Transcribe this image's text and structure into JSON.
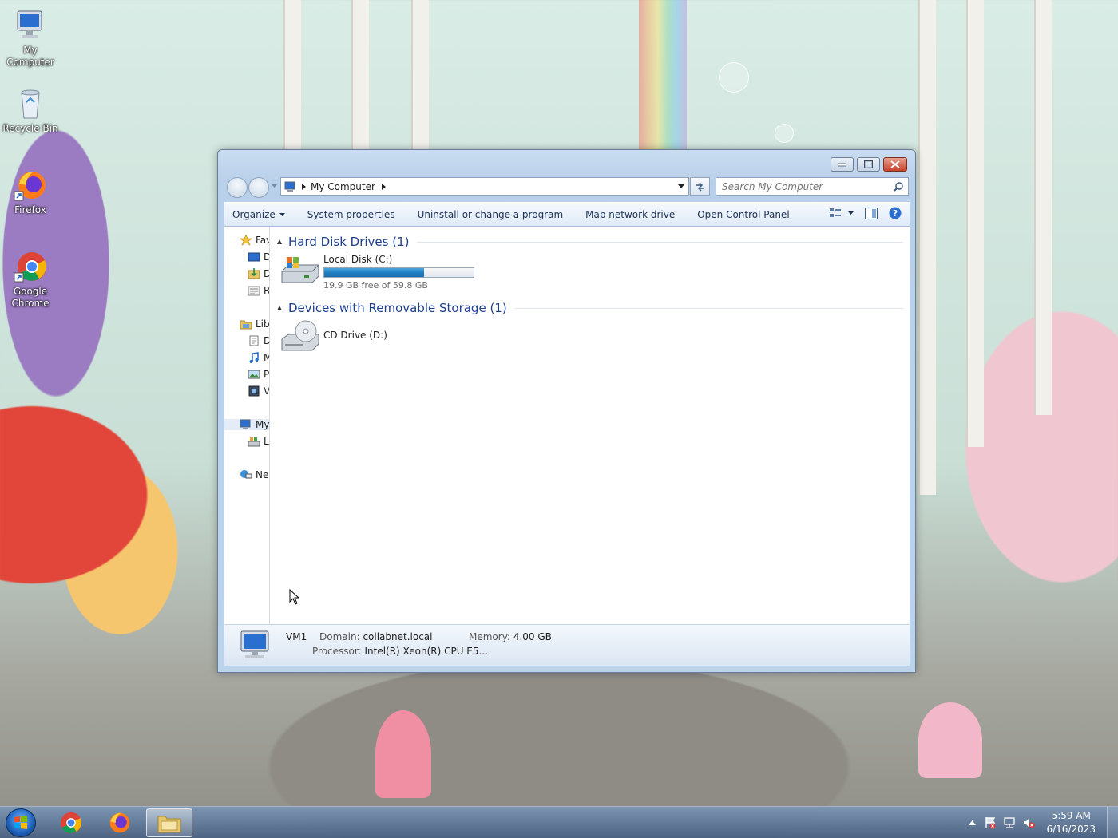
{
  "desktop": {
    "icons": [
      {
        "label": "My Computer"
      },
      {
        "label": "Recycle Bin"
      },
      {
        "label": "Firefox"
      },
      {
        "label": "Google Chrome"
      }
    ]
  },
  "window": {
    "address": {
      "crumb": "My Computer"
    },
    "search": {
      "placeholder": "Search My Computer"
    },
    "toolbar": {
      "organize": "Organize",
      "system_properties": "System properties",
      "uninstall": "Uninstall or change a program",
      "map_drive": "Map network drive",
      "control_panel": "Open Control Panel"
    },
    "nav": {
      "favorites": "Fav",
      "fav_items": [
        "D",
        "D",
        "R"
      ],
      "libraries": "Lib",
      "lib_items": [
        "D",
        "M",
        "P",
        "V"
      ],
      "computer": "My",
      "computer_items": [
        "L"
      ],
      "network": "Ne"
    },
    "groups": {
      "hard_disks": "Hard Disk Drives (1)",
      "removable": "Devices with Removable Storage (1)"
    },
    "drives": {
      "c": {
        "name": "Local Disk (C:)",
        "free_text": "19.9 GB free of 59.8 GB",
        "used_fraction": 0.667
      },
      "d": {
        "name": "CD Drive (D:)"
      }
    },
    "details": {
      "name": "VM1",
      "domain_label": "Domain:",
      "domain_value": "collabnet.local",
      "memory_label": "Memory:",
      "memory_value": "4.00 GB",
      "processor_label": "Processor:",
      "processor_value": "Intel(R) Xeon(R) CPU E5..."
    }
  },
  "taskbar": {
    "clock_time": "5:59 AM",
    "clock_date": "6/16/2023"
  },
  "colors": {
    "accent": "#1e3f8c",
    "progress": "#1f7fc2"
  }
}
